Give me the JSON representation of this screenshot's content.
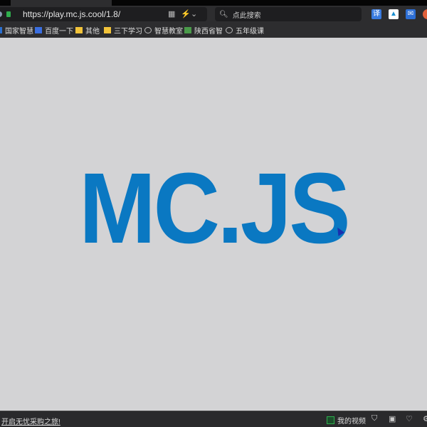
{
  "browser": {
    "url": "https://play.mc.js.cool/1.8/",
    "search_placeholder": "点此搜索",
    "extensions": [
      "translate-icon",
      "app-icon",
      "mail-icon"
    ],
    "bookmarks": [
      "国家智慧",
      "百度一下",
      "其他",
      "三下学习",
      "智慧教室",
      "陕西省智",
      "五年级课"
    ]
  },
  "page": {
    "logo_text": "MC.JS",
    "logo_color": "#0a78c2"
  },
  "statusbar": {
    "promo": "开启无忧采购之旅!",
    "video_label": "我的视频"
  }
}
